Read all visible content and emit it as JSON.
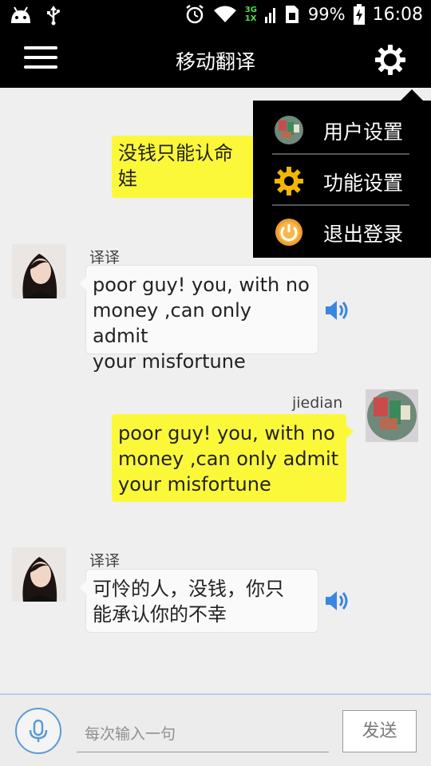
{
  "status_bar": {
    "network_label_top": "3G",
    "network_label_bottom": "1X",
    "battery": "99%",
    "time": "16:08"
  },
  "header": {
    "title": "移动翻译"
  },
  "messages": [
    {
      "side": "right",
      "text": "没钱只能认命娃",
      "line1": "没钱只能认命",
      "line2": "娃"
    },
    {
      "side": "left",
      "sender": "译译",
      "line1": "poor guy! you, with no",
      "line2": "money ,can only admit",
      "line3": "your misfortune",
      "has_audio": true
    },
    {
      "side": "right",
      "sender": "jiedian",
      "line1": "poor guy! you, with no",
      "line2": "money ,can only admit",
      "line3": "your misfortune"
    },
    {
      "side": "left",
      "sender": "译译",
      "line1": "可怜的人，没钱，你只",
      "line2": "能承认你的不幸",
      "has_audio": true
    }
  ],
  "dropdown_menu": {
    "items": [
      {
        "label": "用户设置",
        "icon": "user-avatar-icon"
      },
      {
        "label": "功能设置",
        "icon": "gear-icon"
      },
      {
        "label": "退出登录",
        "icon": "power-icon"
      }
    ]
  },
  "input_bar": {
    "placeholder": "每次输入一句",
    "send_label": "发送"
  },
  "colors": {
    "bubble_yellow": "#fbf83a",
    "bubble_white": "#fafafa",
    "accent_blue": "#5b9ad6",
    "speaker_blue": "#3b86e0"
  }
}
